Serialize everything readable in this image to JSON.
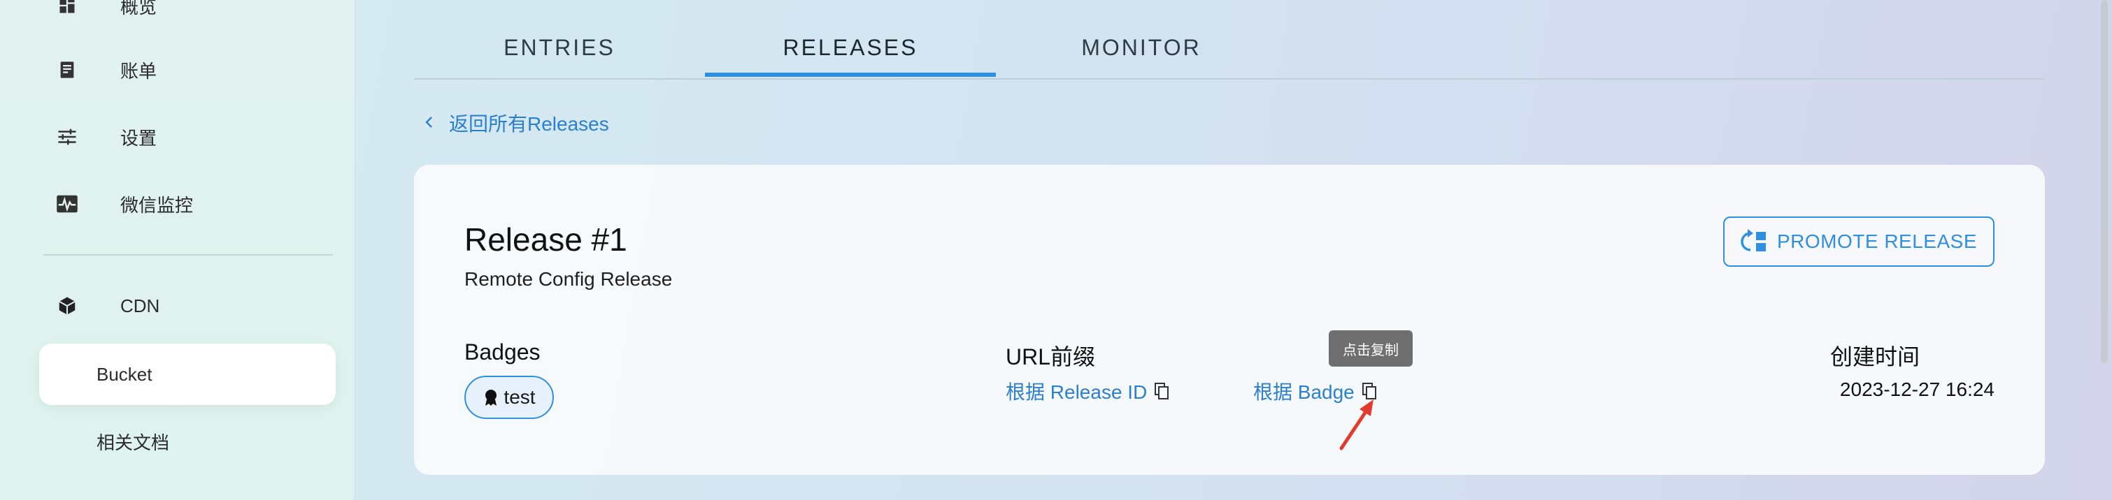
{
  "sidebar": {
    "items": [
      {
        "label": "概览",
        "icon": "dashboard-icon"
      },
      {
        "label": "账单",
        "icon": "bill-icon"
      },
      {
        "label": "设置",
        "icon": "sliders-icon"
      },
      {
        "label": "微信监控",
        "icon": "monitor-pulse-icon"
      },
      {
        "label": "CDN",
        "icon": "cube-icon"
      },
      {
        "label": "Bucket",
        "icon": ""
      },
      {
        "label": "相关文档",
        "icon": ""
      }
    ],
    "active_index": 5
  },
  "tabs": {
    "items": [
      "ENTRIES",
      "RELEASES",
      "MONITOR"
    ],
    "active": "RELEASES"
  },
  "back_link": {
    "label": "返回所有Releases"
  },
  "release": {
    "title": "Release #1",
    "subtitle": "Remote Config Release",
    "promote_label": "PROMOTE RELEASE",
    "badges_heading": "Badges",
    "badges": [
      "test"
    ],
    "url_prefix_heading": "URL前缀",
    "url_by_release_id": "根据 Release ID",
    "url_by_badge": "根据 Badge",
    "tooltip": "点击复制",
    "created_heading": "创建时间",
    "created_value": "2023-12-27 16:24"
  },
  "colors": {
    "accent": "#2f8fe0",
    "link": "#2b7fd0",
    "annotation_arrow": "#e53a2b"
  }
}
